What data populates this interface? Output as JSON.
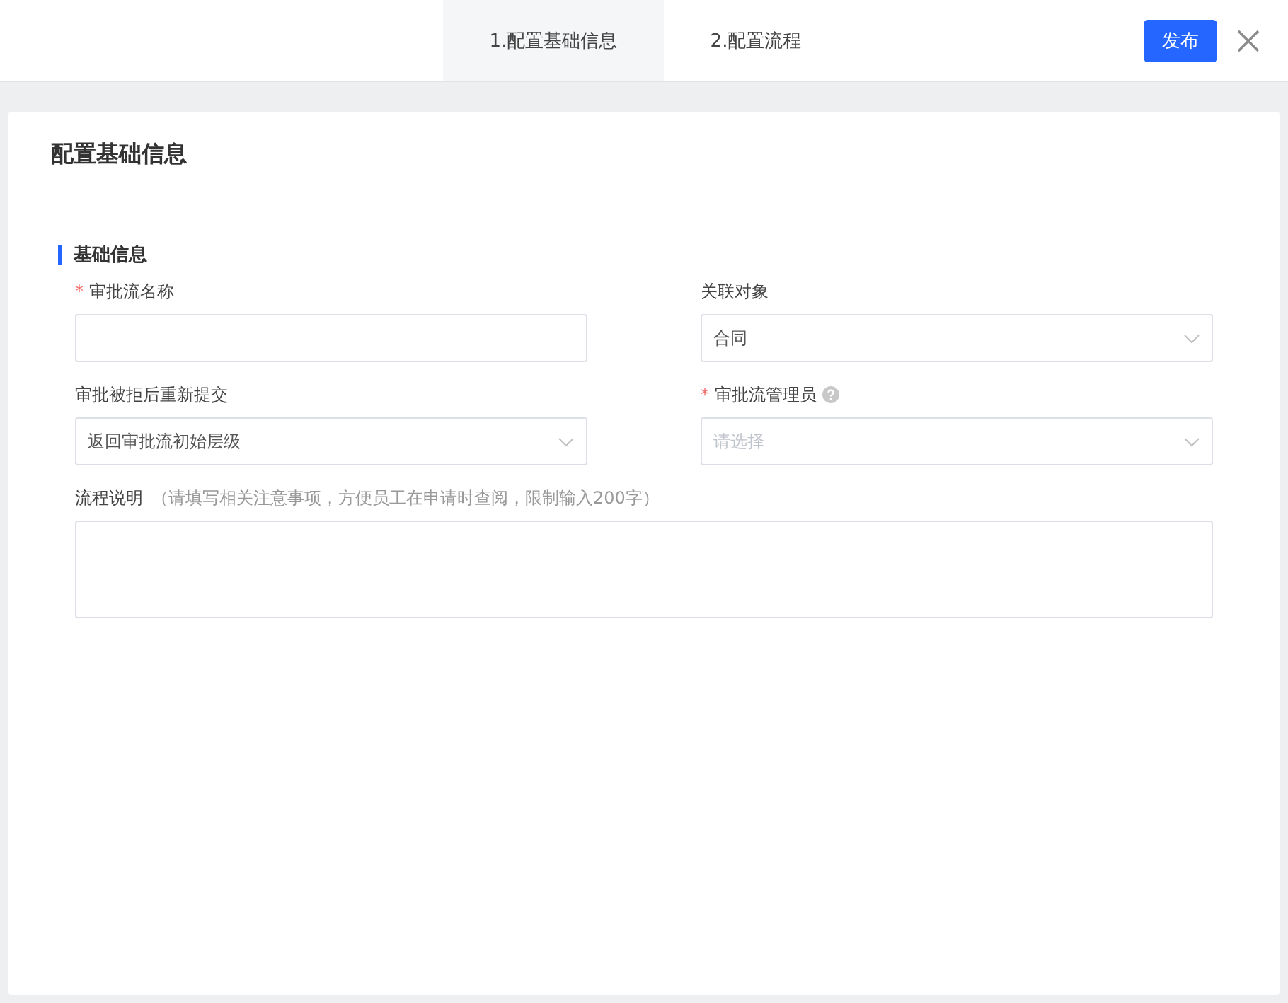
{
  "tabs": [
    {
      "label": "1.配置基础信息",
      "selected": true
    },
    {
      "label": "2.配置流程",
      "selected": false
    }
  ],
  "publish_button": "发布",
  "card": {
    "title": "配置基础信息",
    "section": "基础信息",
    "fields": [
      {
        "kind": "text",
        "label": "审批流名称",
        "required_mark": "*"
      },
      {
        "kind": "select",
        "label": "关联对象",
        "value": "合同"
      },
      {
        "kind": "select",
        "label": "审批被拒后重新提交",
        "value": "返回审批流初始层级"
      },
      {
        "kind": "select",
        "label": "审批流管理员",
        "required_mark": "*",
        "help": true,
        "placeholder": "请选择"
      },
      {
        "kind": "textarea",
        "label": "流程说明",
        "hint": "（请填写相关注意事项，方便员工在申请时查阅，限制输入200字）"
      }
    ]
  }
}
